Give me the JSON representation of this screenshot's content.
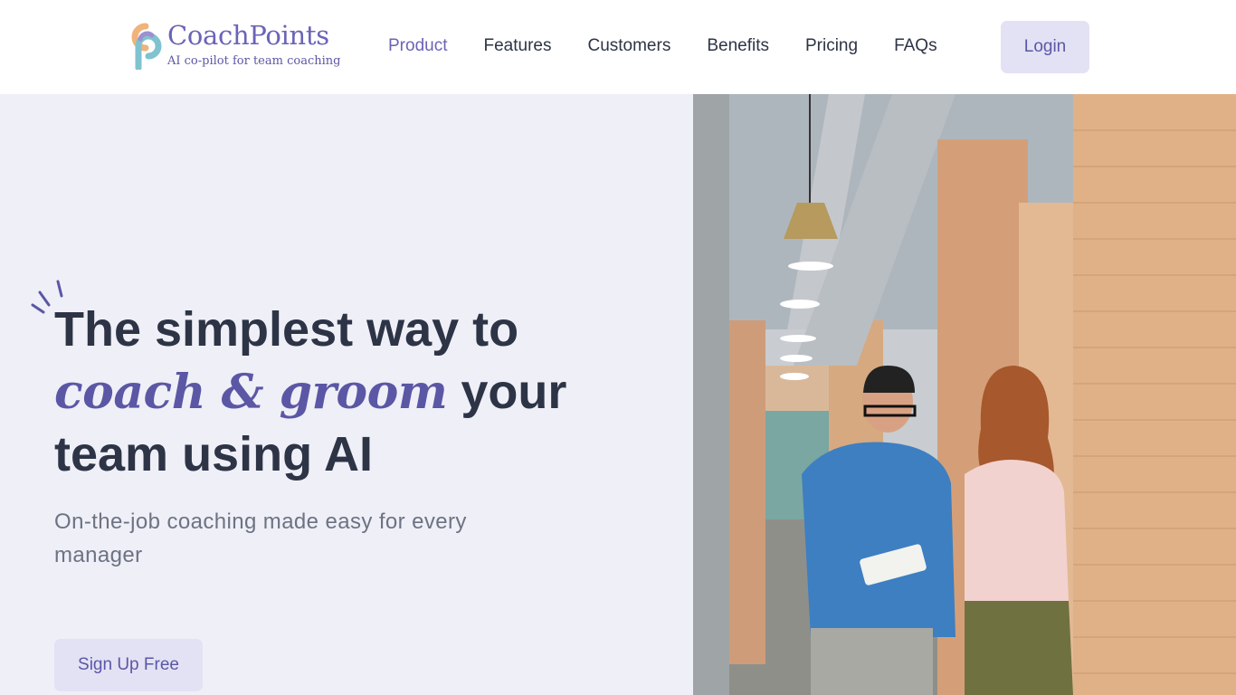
{
  "brand": {
    "name": "CoachPoints",
    "tagline": "AI co-pilot for team coaching",
    "colors": {
      "primary": "#6a64b7",
      "button_bg": "#e3e2f5",
      "hero_bg": "#efeff7",
      "text_dark": "#2d3446"
    }
  },
  "nav": {
    "items": [
      {
        "label": "Product",
        "active": true
      },
      {
        "label": "Features",
        "active": false
      },
      {
        "label": "Customers",
        "active": false
      },
      {
        "label": "Benefits",
        "active": false
      },
      {
        "label": "Pricing",
        "active": false
      },
      {
        "label": "FAQs",
        "active": false
      }
    ],
    "login_label": "Login"
  },
  "hero": {
    "headline_part1": "The simplest way to",
    "headline_accent": "coach & groom",
    "headline_part2": " your",
    "headline_part3": "team using AI",
    "subheading": "On-the-job coaching made easy for every manager",
    "cta_label": "Sign Up Free",
    "image": "photo-two-colleagues-walking-in-office-hallway"
  }
}
